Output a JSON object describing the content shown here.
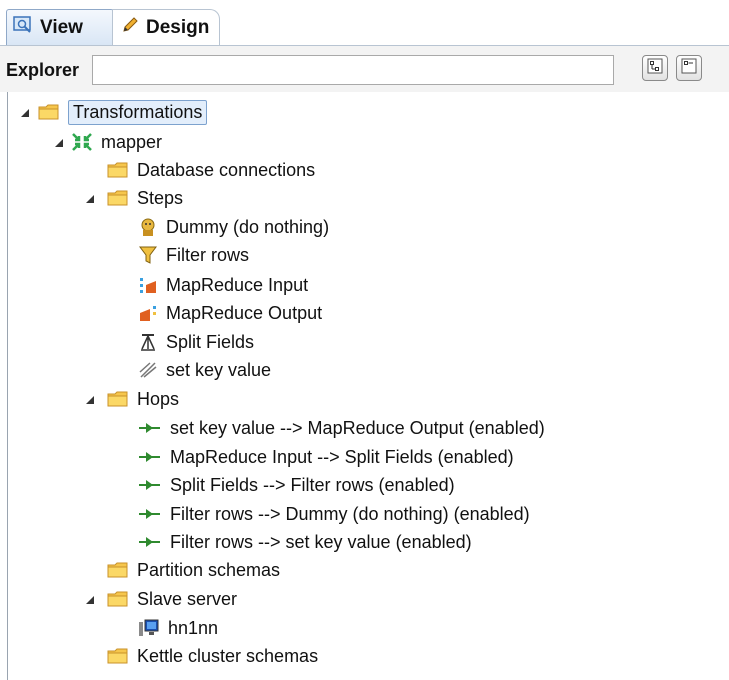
{
  "tabs": [
    {
      "label": "View",
      "icon": "view-icon"
    },
    {
      "label": "Design",
      "icon": "pencil-icon"
    }
  ],
  "explorer": {
    "label": "Explorer",
    "value": ""
  },
  "toolbar": {
    "expand_icon": "expand-all-icon",
    "collapse_icon": "collapse-all-icon"
  },
  "tree": {
    "root": "Transformations",
    "mapper": "mapper",
    "database_connections": "Database connections",
    "steps": {
      "label": "Steps",
      "items": [
        "Dummy (do nothing)",
        "Filter rows",
        "MapReduce Input",
        "MapReduce Output",
        "Split Fields",
        "set key value"
      ]
    },
    "hops": {
      "label": "Hops",
      "items": [
        "set key value --> MapReduce Output (enabled)",
        "MapReduce Input --> Split Fields (enabled)",
        "Split Fields --> Filter rows (enabled)",
        "Filter rows --> Dummy (do nothing) (enabled)",
        "Filter rows --> set key value (enabled)"
      ]
    },
    "partition_schemas": "Partition schemas",
    "slave_server": {
      "label": "Slave server",
      "items": [
        "hn1nn"
      ]
    },
    "kettle_cluster_schemas": "Kettle cluster schemas"
  },
  "colors": {
    "folder": "#f6c64c",
    "hop_arrow": "#2f8a2f",
    "selection": "#e3eefb"
  }
}
